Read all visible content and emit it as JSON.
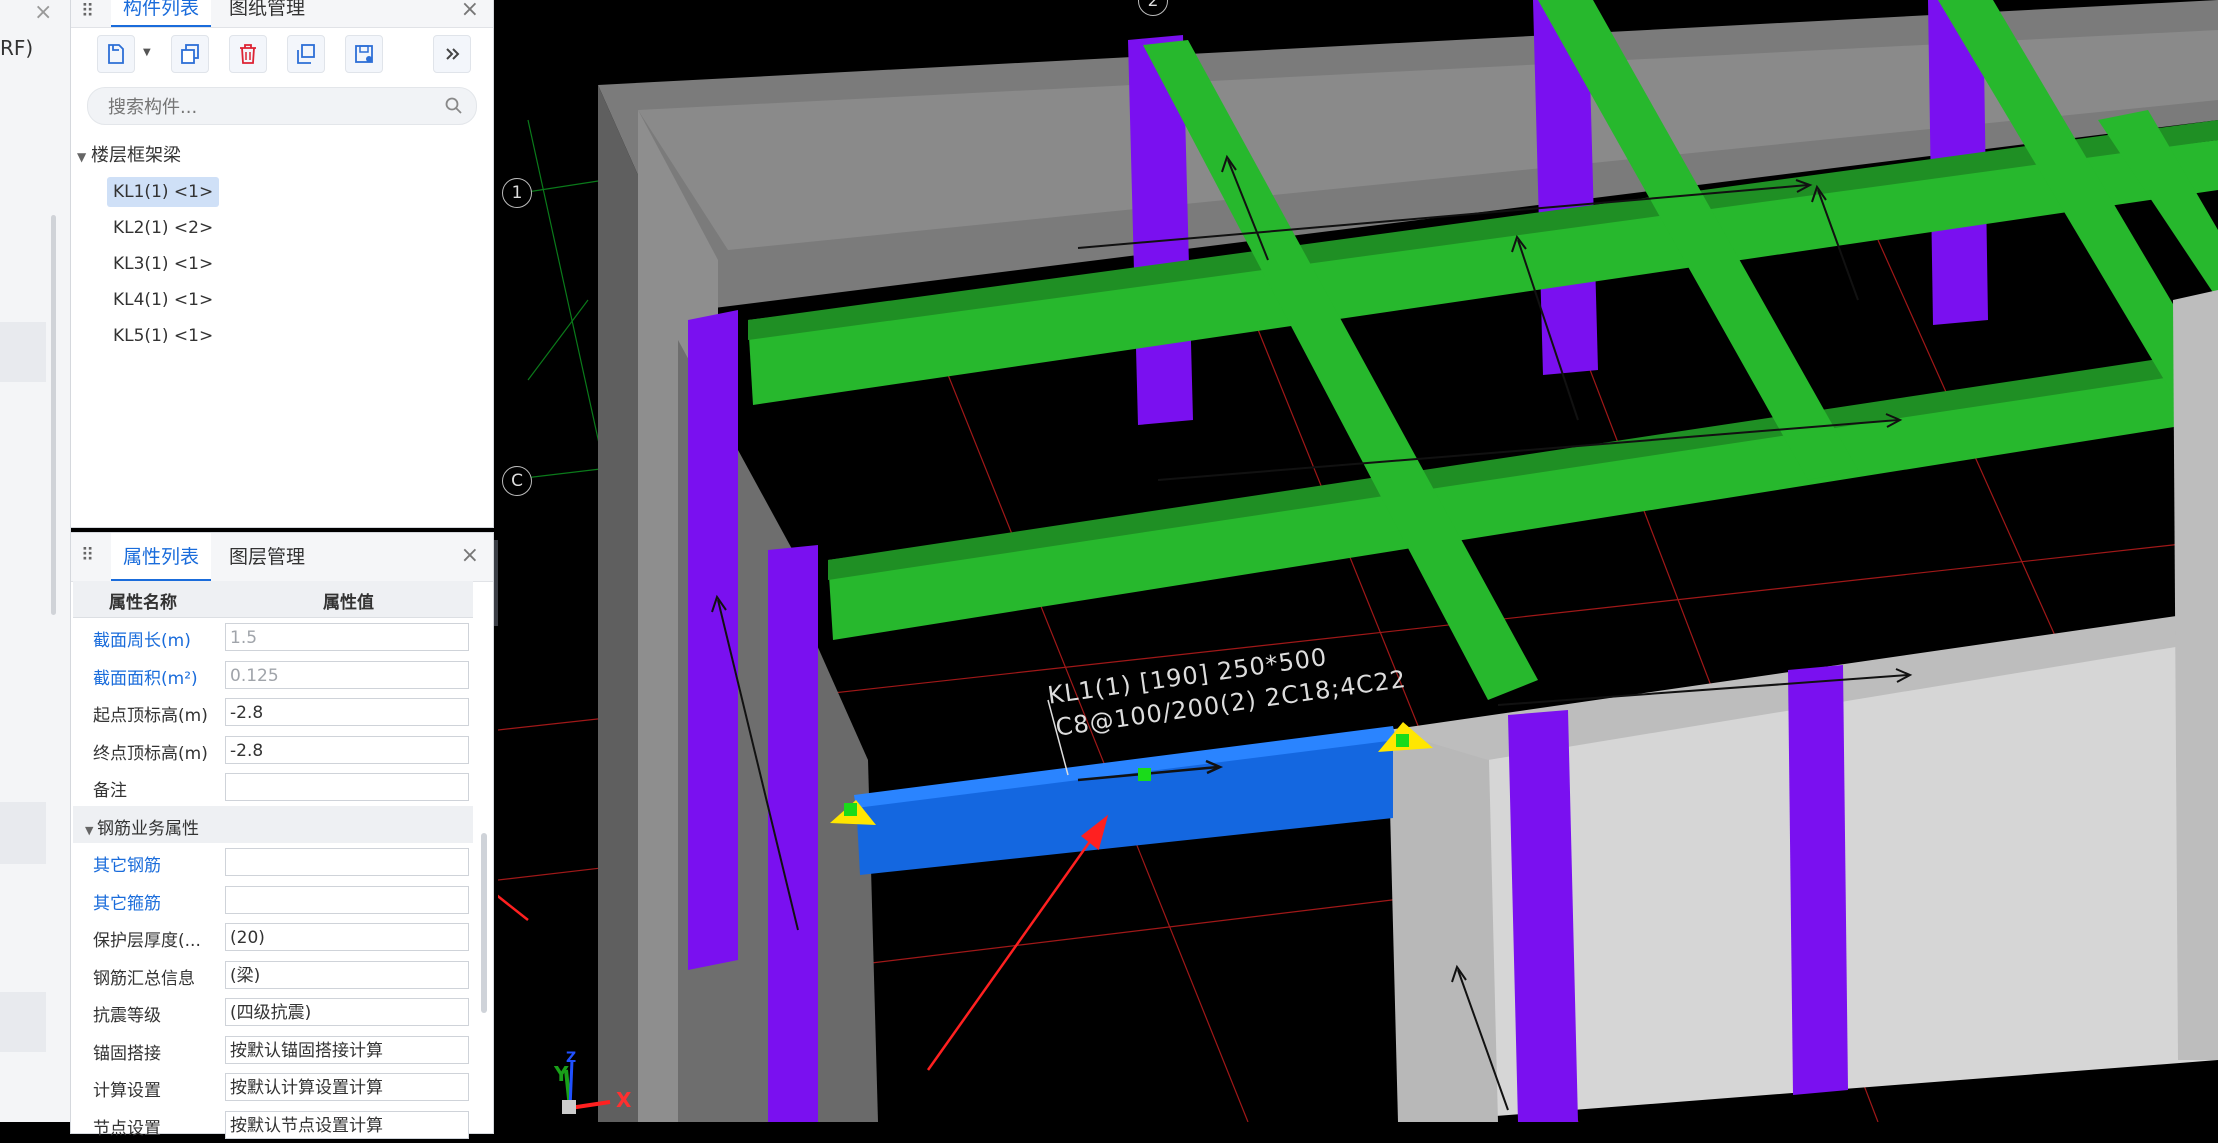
{
  "left_strip": {
    "text": "RF)",
    "close": "×"
  },
  "component_panel": {
    "tabs": [
      "构件列表",
      "图纸管理"
    ],
    "close": "×",
    "toolbar_icons": [
      "new-component-icon",
      "copy-icon",
      "delete-icon",
      "copy-floor-icon",
      "save-icon",
      "more-icon"
    ],
    "search_placeholder": "搜索构件...",
    "tree_group": "楼层框架梁",
    "items": [
      {
        "label": "KL1(1) <1>",
        "selected": true
      },
      {
        "label": "KL2(1) <2>"
      },
      {
        "label": "KL3(1) <1>"
      },
      {
        "label": "KL4(1) <1>"
      },
      {
        "label": "KL5(1) <1>"
      }
    ]
  },
  "property_panel": {
    "tabs": [
      "属性列表",
      "图层管理"
    ],
    "close": "×",
    "header_name": "属性名称",
    "header_value": "属性值",
    "rows": [
      {
        "name": "截面周长(m)",
        "value": "1.5",
        "blue": true,
        "gray": true
      },
      {
        "name": "截面面积(m²)",
        "value": "0.125",
        "blue": true,
        "gray": true
      },
      {
        "name": "起点顶标高(m)",
        "value": "-2.8"
      },
      {
        "name": "终点顶标高(m)",
        "value": "-2.8"
      },
      {
        "name": "备注",
        "value": ""
      }
    ],
    "section": "钢筋业务属性",
    "section_rows": [
      {
        "name": "其它钢筋",
        "value": "",
        "blue": true
      },
      {
        "name": "其它箍筋",
        "value": "",
        "blue": true
      },
      {
        "name": "保护层厚度(...",
        "value": "(20)"
      },
      {
        "name": "钢筋汇总信息",
        "value": "(梁)"
      },
      {
        "name": "抗震等级",
        "value": "(四级抗震)"
      },
      {
        "name": "锚固搭接",
        "value": "按默认锚固搭接计算"
      },
      {
        "name": "计算设置",
        "value": "按默认计算设置计算"
      },
      {
        "name": "节点设置",
        "value": "按默认节点设置计算"
      }
    ]
  },
  "viewport": {
    "beam_label_line1": "KL1(1) [190] 250*500",
    "beam_label_line2": "C8@100/200(2) 2C18;4C22",
    "axis_labels": [
      "2",
      "1",
      "C"
    ],
    "coord_x": "X",
    "coord_y": "Y",
    "coord_z": "Z",
    "colors": {
      "beam_green": "#27b82d",
      "beam_selected": "#1467e0",
      "column_purple": "#7a10f0",
      "wall_gray": "#8a8a8a",
      "grip_yellow": "#ffe600",
      "arrow_red": "#ff2020"
    }
  }
}
